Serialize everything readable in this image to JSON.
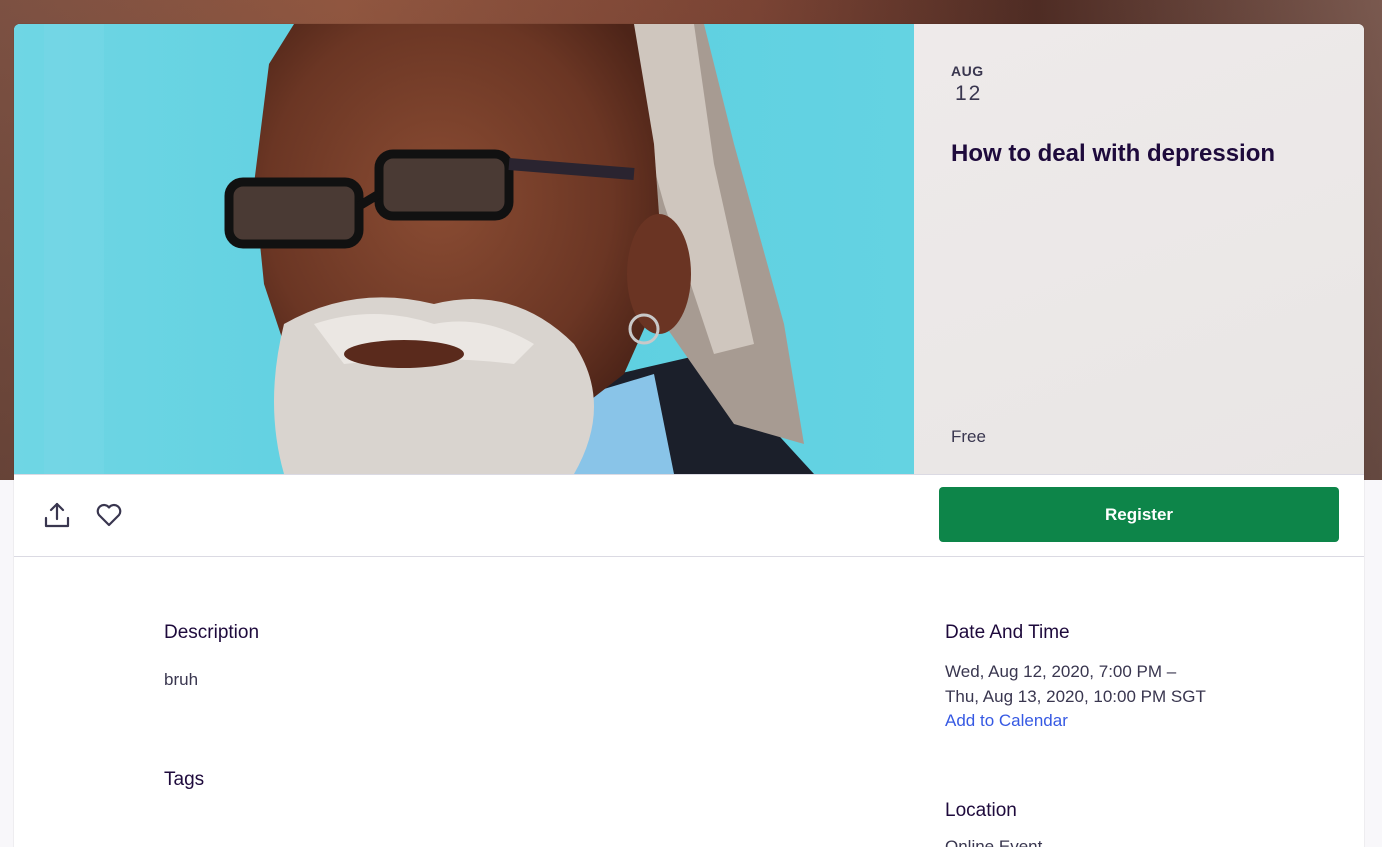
{
  "event": {
    "month": "AUG",
    "day": "12",
    "title": "How to deal with depression",
    "price": "Free"
  },
  "actions": {
    "share_icon": "share-upload-icon",
    "like_icon": "heart-icon",
    "register_label": "Register"
  },
  "details": {
    "description_heading": "Description",
    "description_text": "bruh",
    "tags_heading": "Tags",
    "datetime_heading": "Date And Time",
    "datetime_line1": "Wed, Aug 12, 2020, 7:00 PM –",
    "datetime_line2": "Thu, Aug 13, 2020, 10:00 PM SGT",
    "add_to_calendar": "Add to Calendar",
    "location_heading": "Location",
    "location_text": "Online Event"
  },
  "colors": {
    "brand_green": "#0d8549",
    "link_blue": "#3659e3",
    "heading_text": "#1e0a3c"
  }
}
